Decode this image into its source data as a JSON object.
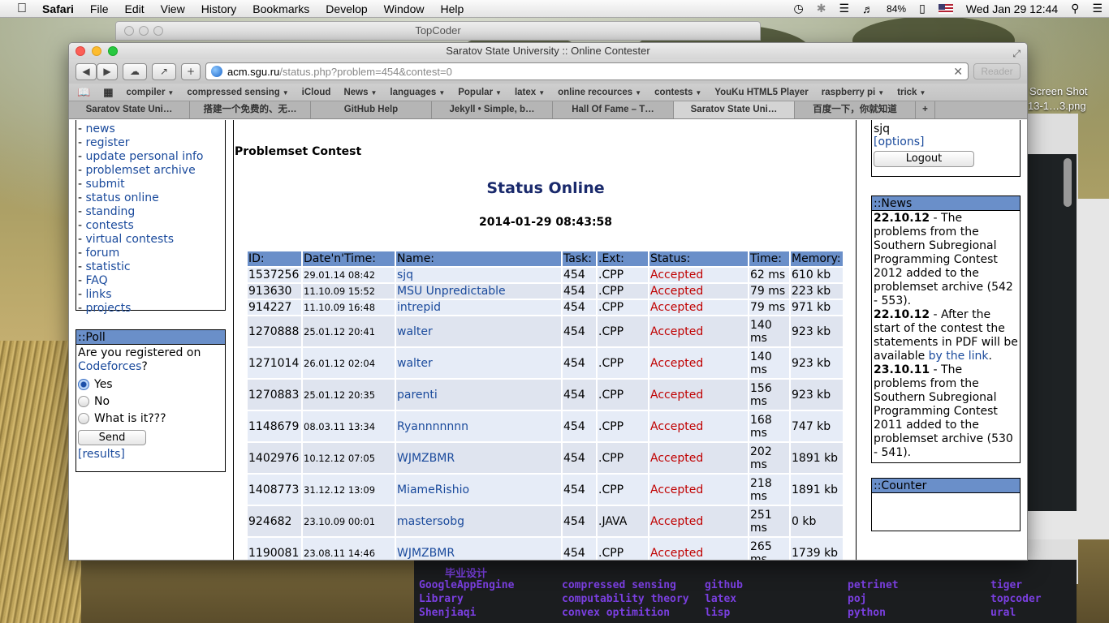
{
  "menubar": {
    "app": "Safari",
    "menus": [
      "File",
      "Edit",
      "View",
      "History",
      "Bookmarks",
      "Develop",
      "Window",
      "Help"
    ],
    "battery": "84%",
    "clock": "Wed Jan 29  12:44"
  },
  "bg_window": {
    "title": "TopCoder"
  },
  "desktop": {
    "screenshot_label_1": "Screen Shot",
    "screenshot_label_2": "13-1…3.png"
  },
  "terminal": {
    "words": [
      "毕业设计",
      "GoogleAppEngine",
      "Library",
      "Shenjiaqi",
      "compressed sensing",
      "computability theory",
      "convex optimition",
      "github",
      "latex",
      "lisp",
      "petrinet",
      "poj",
      "python",
      "tiger",
      "topcoder",
      "ural"
    ]
  },
  "window": {
    "title": "Saratov State University :: Online Contester"
  },
  "toolbar": {
    "url_host": "acm.sgu.ru",
    "url_path": "/status.php?problem=454&contest=0",
    "reader": "Reader",
    "clear_glyph": "✕"
  },
  "bookmarks": [
    "compiler",
    "compressed sensing",
    "iCloud",
    "News",
    "languages",
    "Popular",
    "latex",
    "online recources",
    "contests",
    "YouKu HTML5 Player",
    "raspberry pi",
    "trick"
  ],
  "tabs": [
    "Saratov State Uni…",
    "搭建一个免费的、无…",
    "GitHub Help",
    "Jekyll • Simple, b…",
    "Hall Of Fame – T…",
    "Saratov State Uni…",
    "百度一下，你就知道"
  ],
  "nav": [
    "news",
    "register",
    "update personal info",
    "problemset archive",
    "submit",
    "status online",
    "standing",
    "contests",
    "virtual contests",
    "forum",
    "statistic",
    "FAQ",
    "links",
    "projects"
  ],
  "poll": {
    "title": "::Poll",
    "question_prefix": "Are you registered on",
    "question_link": "Codeforces",
    "question_suffix": "?",
    "options": [
      {
        "label": "Yes",
        "selected": true
      },
      {
        "label": "No",
        "selected": false
      },
      {
        "label": "What is it???",
        "selected": false
      }
    ],
    "send": "Send",
    "results": "[results]"
  },
  "main": {
    "problemset": "Problemset Contest",
    "status_title": "Status Online",
    "datetime": "2014-01-29 08:43:58",
    "headers": [
      "ID:",
      "Date'n'Time:",
      "Name:",
      "Task:",
      ".Ext:",
      "Status:",
      "Time:",
      "Memory:"
    ],
    "rows": [
      {
        "id": "1537256",
        "dt": "29.01.14 08:42",
        "name": "sjq",
        "task": "454",
        "ext": ".CPP",
        "status": "Accepted",
        "time": "62 ms",
        "mem": "610 kb"
      },
      {
        "id": "913630",
        "dt": "11.10.09 15:52",
        "name": "MSU Unpredictable",
        "task": "454",
        "ext": ".CPP",
        "status": "Accepted",
        "time": "79 ms",
        "mem": "223 kb"
      },
      {
        "id": "914227",
        "dt": "11.10.09 16:48",
        "name": "intrepid",
        "task": "454",
        "ext": ".CPP",
        "status": "Accepted",
        "time": "79 ms",
        "mem": "971 kb"
      },
      {
        "id": "1270888",
        "dt": "25.01.12 20:41",
        "name": "walter",
        "task": "454",
        "ext": ".CPP",
        "status": "Accepted",
        "time": "140 ms",
        "mem": "923 kb"
      },
      {
        "id": "1271014",
        "dt": "26.01.12 02:04",
        "name": "walter",
        "task": "454",
        "ext": ".CPP",
        "status": "Accepted",
        "time": "140 ms",
        "mem": "923 kb"
      },
      {
        "id": "1270883",
        "dt": "25.01.12 20:35",
        "name": "parenti",
        "task": "454",
        "ext": ".CPP",
        "status": "Accepted",
        "time": "156 ms",
        "mem": "923 kb"
      },
      {
        "id": "1148679",
        "dt": "08.03.11 13:34",
        "name": "Ryannnnnnn",
        "task": "454",
        "ext": ".CPP",
        "status": "Accepted",
        "time": "168 ms",
        "mem": "747 kb"
      },
      {
        "id": "1402976",
        "dt": "10.12.12 07:05",
        "name": "WJMZBMR",
        "task": "454",
        "ext": ".CPP",
        "status": "Accepted",
        "time": "202 ms",
        "mem": "1891 kb"
      },
      {
        "id": "1408773",
        "dt": "31.12.12 13:09",
        "name": "MiameRishio",
        "task": "454",
        "ext": ".CPP",
        "status": "Accepted",
        "time": "218 ms",
        "mem": "1891 kb"
      },
      {
        "id": "924682",
        "dt": "23.10.09 00:01",
        "name": "mastersobg",
        "task": "454",
        "ext": ".JAVA",
        "status": "Accepted",
        "time": "251 ms",
        "mem": "0 kb"
      },
      {
        "id": "1190081",
        "dt": "23.08.11 14:46",
        "name": "WJMZBMR",
        "task": "454",
        "ext": ".CPP",
        "status": "Accepted",
        "time": "265 ms",
        "mem": "1739 kb"
      }
    ]
  },
  "user": {
    "name": "sjq",
    "options": "[options]",
    "logout": "Logout"
  },
  "news": {
    "title": "::News",
    "items": [
      {
        "date": "22.10.12",
        "text": " - The problems from the Southern Subregional Programming Contest 2012 added to the problemset archive (542 - 553)."
      },
      {
        "date": "22.10.12",
        "text": " - After the start of the contest the statements in PDF will be available ",
        "link": "by the link",
        "after": "."
      },
      {
        "date": "23.10.11",
        "text": " - The problems from the Southern Subregional Programming Contest 2011 added to the problemset archive (530 - 541)."
      }
    ]
  },
  "counter": {
    "title": "::Counter"
  }
}
